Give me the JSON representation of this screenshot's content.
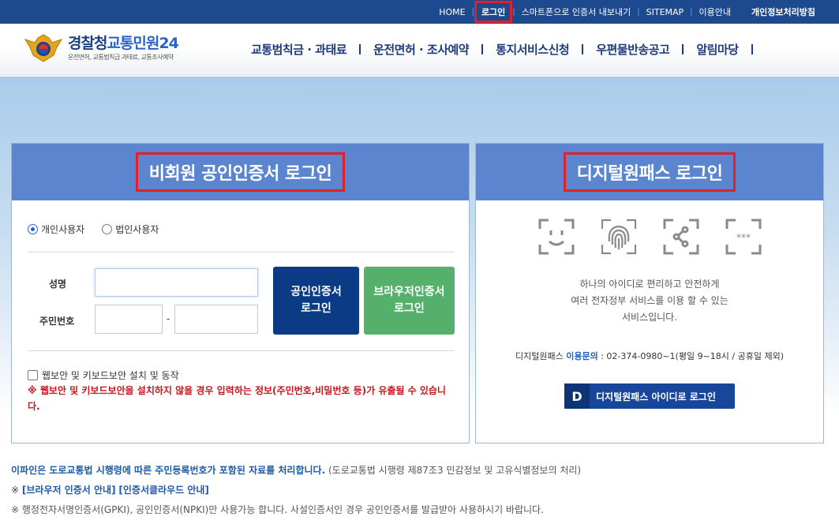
{
  "topnav": {
    "items": [
      {
        "label": "HOME"
      },
      {
        "label": "로그인"
      },
      {
        "label": "스마트폰으로 인증서 내보내기"
      },
      {
        "label": "SITEMAP"
      },
      {
        "label": "이용안내"
      },
      {
        "label": "개인정보처리방침"
      }
    ]
  },
  "header": {
    "logo_title_a": "경찰청",
    "logo_title_b": "교통민원24",
    "logo_sub": "운전면허, 교통범칙금 과태료, 교통조사예약",
    "gnb": [
      "교통범칙금 · 과태료",
      "운전면허 · 조사예약",
      "통지서비스신청",
      "우편물반송공고",
      "알림마당"
    ]
  },
  "left_panel": {
    "title": "비회원 공인인증서 로그인",
    "radio_personal": "개인사용자",
    "radio_corporate": "법인사용자",
    "name_label": "성명",
    "rrn_label": "주민번호",
    "dash": "-",
    "cert_btn_line1": "공인인증서",
    "cert_btn_line2": "로그인",
    "browser_btn_line1": "브라우저인증서",
    "browser_btn_line2": "로그인",
    "security_label": "웹보안 및 키보드보안 설치 및 동작",
    "warning": "※ 웹보안 및 키보드보안을 설치하지 않을 경우 입력하는 정보(주민번호,비밀번호 등)가 유출될 수 있습니다."
  },
  "right_panel": {
    "title": "디지털원패스 로그인",
    "desc_line1": "하나의 아이디로 편리하고 안전하게",
    "desc_line2": "여러 전자정부 서비스를 이용 할 수 있는",
    "desc_line3": "서비스입니다.",
    "contact_prefix": "디지털원패스",
    "contact_em": "이용문의",
    "contact_rest": ": 02-374-0980~1(평일 9~18시 / 공휴일 제외)",
    "btn_d": "D",
    "btn_label": "디지털원패스 아이디로 로그인",
    "icon_dots": "***"
  },
  "notes": {
    "line1_bold": "이파인은 도로교통법 시행령에 따른 주민등록번호가 포함된 자료를 처리합니다.",
    "line1_rest": "(도로교통법 시행령 제87조3 민감정보 및 고유식별정보의 처리)",
    "line2_prefix": "※",
    "line2_link1": "[브라우저 인증서 안내]",
    "line2_link2": "[인증서클라우드 안내]",
    "line3": "※ 행정전자서명인증서(GPKI), 공인인증서(NPKI)만 사용가능 합니다. 사설인증서인 경우 공인인증서를 발급받아 사용하시기 바랍니다."
  },
  "colors": {
    "topbar": "#1d4a8f",
    "panel_header": "#5b86cf",
    "cert_button": "#0b3b85",
    "browser_button": "#55b06c",
    "warning": "#c8161e",
    "highlight_box": "#e0202a"
  }
}
